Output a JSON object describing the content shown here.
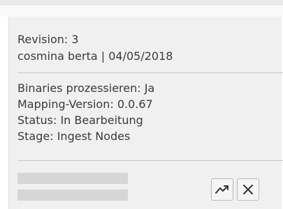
{
  "card": {
    "revision": "Revision: 3",
    "author_date": "cosmina berta | 04/05/2018",
    "details": [
      "Binaries prozessieren: Ja",
      "Mapping-Version: 0.0.67",
      "Status: In Bearbeitung",
      "Stage: Ingest Nodes"
    ]
  },
  "actions": {
    "trend_icon": "trending-up-icon",
    "close_icon": "close-icon"
  }
}
